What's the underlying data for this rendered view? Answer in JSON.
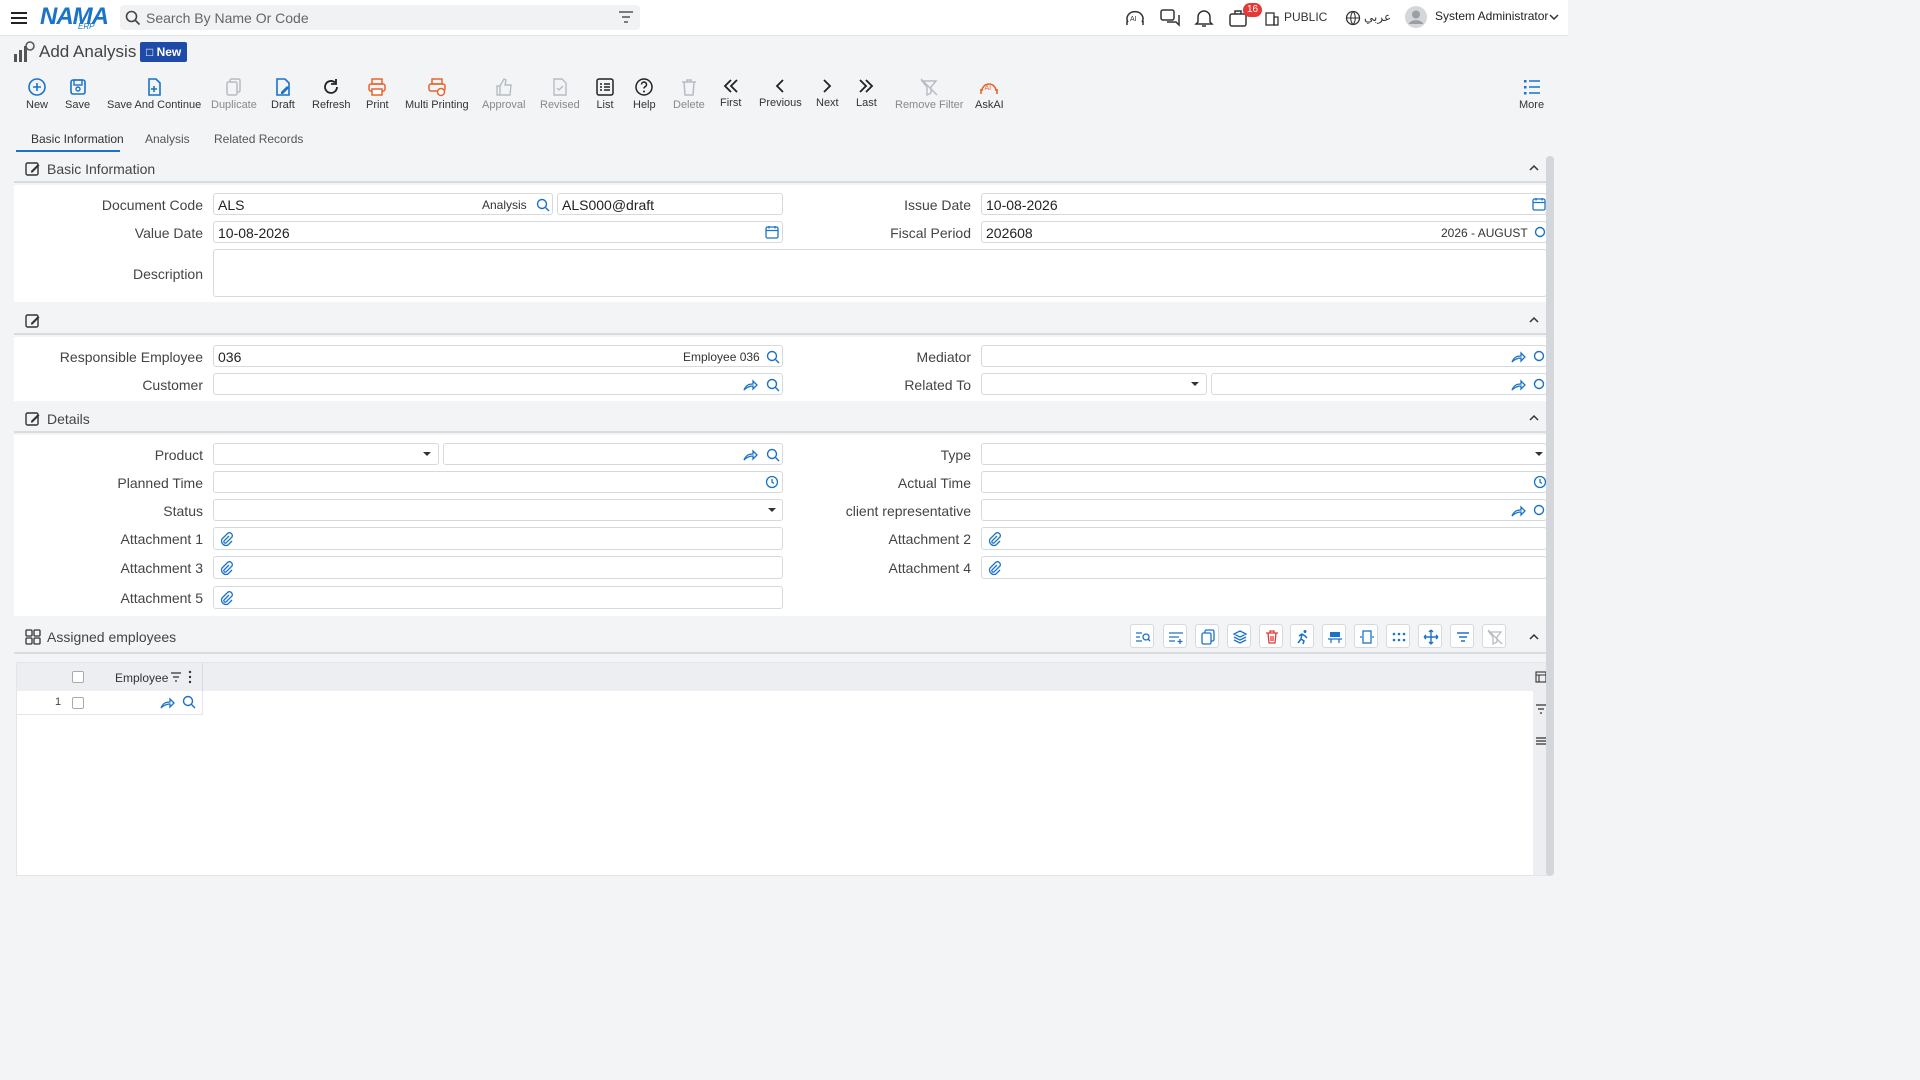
{
  "app": {
    "logo": "NAMA",
    "logo_sub": "ERP",
    "search_placeholder": "Search By Name Or Code",
    "notifications_count": "16",
    "branch": "PUBLIC",
    "language": "عربي",
    "user": "System Administrator"
  },
  "page": {
    "title": "Add Analysis",
    "status_badge": "New"
  },
  "toolbar": {
    "new": "New",
    "save": "Save",
    "save_continue": "Save And Continue",
    "duplicate": "Duplicate",
    "draft": "Draft",
    "refresh": "Refresh",
    "print": "Print",
    "multi_printing": "Multi Printing",
    "approval": "Approval",
    "revised": "Revised",
    "list": "List",
    "help": "Help",
    "delete": "Delete",
    "first": "First",
    "previous": "Previous",
    "next": "Next",
    "last": "Last",
    "remove_filter": "Remove Filter",
    "askai": "AskAI",
    "more": "More"
  },
  "tabs": [
    "Basic Information",
    "Analysis",
    "Related Records"
  ],
  "sections": {
    "basic": "Basic Information",
    "details": "Details",
    "assigned": "Assigned employees"
  },
  "form": {
    "document_code_label": "Document Code",
    "document_code": "ALS",
    "document_code_type": "Analysis",
    "document_code_full": "ALS000@draft",
    "issue_date_label": "Issue Date",
    "issue_date": "10-08-2026",
    "value_date_label": "Value Date",
    "value_date": "10-08-2026",
    "fiscal_period_label": "Fiscal Period",
    "fiscal_period": "202608",
    "fiscal_period_name": "2026 - AUGUST",
    "description_label": "Description",
    "responsible_employee_label": "Responsible Employee",
    "responsible_employee": "036",
    "responsible_employee_name": "Employee 036",
    "mediator_label": "Mediator",
    "customer_label": "Customer",
    "related_to_label": "Related To",
    "product_label": "Product",
    "type_label": "Type",
    "planned_time_label": "Planned Time",
    "actual_time_label": "Actual Time",
    "status_label": "Status",
    "client_rep_label": "client representative",
    "attachment1_label": "Attachment 1",
    "attachment2_label": "Attachment 2",
    "attachment3_label": "Attachment 3",
    "attachment4_label": "Attachment 4",
    "attachment5_label": "Attachment 5"
  },
  "grid": {
    "column_employee": "Employee",
    "rows": [
      {
        "num": "1"
      }
    ]
  },
  "colors": {
    "accent": "#1a73c8",
    "badge": "#1e4ba8",
    "print_orange": "#e8642c",
    "delete_red": "#e53935"
  }
}
